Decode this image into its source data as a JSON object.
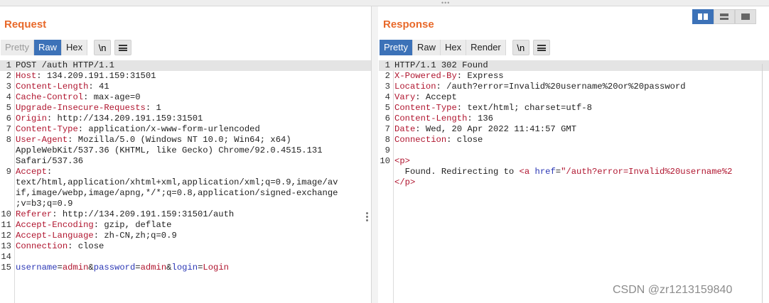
{
  "request": {
    "title": "Request",
    "tabs": [
      "Pretty",
      "Raw",
      "Hex"
    ],
    "active_tab": "Raw",
    "newline_label": "\\n",
    "lines": [
      {
        "n": "1",
        "text": "POST /auth HTTP/1.1"
      },
      {
        "n": "2",
        "name": "Host",
        "value": " 134.209.191.159:31501"
      },
      {
        "n": "3",
        "name": "Content-Length",
        "value": " 41"
      },
      {
        "n": "4",
        "name": "Cache-Control",
        "value": " max-age=0"
      },
      {
        "n": "5",
        "name": "Upgrade-Insecure-Requests",
        "value": " 1"
      },
      {
        "n": "6",
        "name": "Origin",
        "value": " http://134.209.191.159:31501"
      },
      {
        "n": "7",
        "name": "Content-Type",
        "value": " application/x-www-form-urlencoded"
      },
      {
        "n": "8",
        "name": "User-Agent",
        "value": " Mozilla/5.0 (Windows NT 10.0; Win64; x64)\nAppleWebKit/537.36 (KHTML, like Gecko) Chrome/92.0.4515.131\nSafari/537.36"
      },
      {
        "n": "9",
        "name": "Accept",
        "value": "\ntext/html,application/xhtml+xml,application/xml;q=0.9,image/av\nif,image/webp,image/apng,*/*;q=0.8,application/signed-exchange\n;v=b3;q=0.9"
      },
      {
        "n": "10",
        "name": "Referer",
        "value": " http://134.209.191.159:31501/auth"
      },
      {
        "n": "11",
        "name": "Accept-Encoding",
        "value": " gzip, deflate"
      },
      {
        "n": "12",
        "name": "Accept-Language",
        "value": " zh-CN,zh;q=0.9"
      },
      {
        "n": "13",
        "name": "Connection",
        "value": " close"
      },
      {
        "n": "14",
        "text": ""
      },
      {
        "n": "15",
        "body": [
          {
            "k": "username"
          },
          {
            "s": "="
          },
          {
            "v": "admin"
          },
          {
            "s": "&"
          },
          {
            "k": "password"
          },
          {
            "s": "="
          },
          {
            "v": "admin"
          },
          {
            "s": "&"
          },
          {
            "k": "login"
          },
          {
            "s": "="
          },
          {
            "v": "Login"
          }
        ]
      }
    ]
  },
  "response": {
    "title": "Response",
    "tabs": [
      "Pretty",
      "Raw",
      "Hex",
      "Render"
    ],
    "active_tab": "Pretty",
    "newline_label": "\\n",
    "lines": [
      {
        "n": "1",
        "text": "HTTP/1.1 302 Found"
      },
      {
        "n": "2",
        "name": "X-Powered-By",
        "value": " Express"
      },
      {
        "n": "3",
        "name": "Location",
        "value": " /auth?error=Invalid%20username%20or%20password"
      },
      {
        "n": "4",
        "name": "Vary",
        "value": " Accept"
      },
      {
        "n": "5",
        "name": "Content-Type",
        "value": " text/html; charset=utf-8"
      },
      {
        "n": "6",
        "name": "Content-Length",
        "value": " 136"
      },
      {
        "n": "7",
        "name": "Date",
        "value": " Wed, 20 Apr 2022 11:41:57 GMT"
      },
      {
        "n": "8",
        "name": "Connection",
        "value": " close"
      },
      {
        "n": "9",
        "text": ""
      },
      {
        "n": "10",
        "html": [
          {
            "t": "<p>"
          },
          {
            "x": "\n  Found. Redirecting to "
          },
          {
            "t": "<a "
          },
          {
            "a": "href"
          },
          {
            "x": "="
          },
          {
            "s": "\"/auth?error=Invalid%20username%2"
          },
          {
            "x": "\n"
          },
          {
            "t": "</p>"
          }
        ]
      }
    ]
  },
  "layout_modes": [
    "side-by-side",
    "stacked",
    "single"
  ],
  "active_layout": "side-by-side",
  "watermark": "CSDN @zr1213159840",
  "colors": {
    "title": "#e8692a",
    "active_tab": "#3c72b8",
    "header_name": "#b0152f",
    "param_key": "#2b37b5"
  }
}
